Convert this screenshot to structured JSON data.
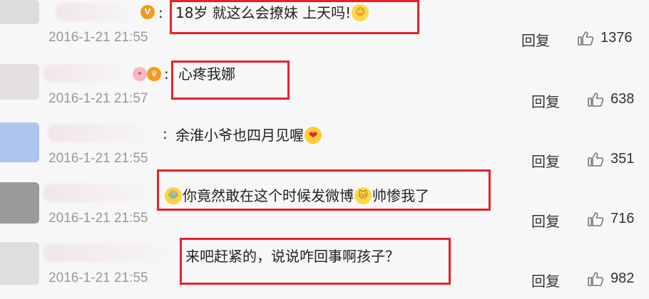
{
  "comments": [
    {
      "text": "18岁 就这么会撩妹 上天吗!",
      "emoji": "wink-emoji",
      "timestamp": "2016-1-21 21:55",
      "reply_label": "回复",
      "likes": "1376",
      "avatar_color": "#dcdcdc"
    },
    {
      "text": "心疼我娜",
      "emoji": "",
      "timestamp": "2016-1-21 21:57",
      "reply_label": "回复",
      "likes": "638",
      "avatar_color": "#e4dfe0"
    },
    {
      "text": "余淮小爷也四月见喔",
      "emoji": "heart-eyes-emoji",
      "timestamp": "2016-1-21 21:55",
      "reply_label": "回复",
      "likes": "351",
      "avatar_color": "#aec6ee"
    },
    {
      "text_before": "你竟然敢在这个时候发微博",
      "text_after": "帅惨我了",
      "emoji_before": "crying-laughing-emoji",
      "emoji_mid": "cat-emoji",
      "timestamp": "2016-1-21 21:55",
      "reply_label": "回复",
      "likes": "716",
      "avatar_color": "#9a9a9a"
    },
    {
      "text": "来吧赶紧的，说说咋回事啊孩子？",
      "timestamp": "2016-1-21 21:55",
      "reply_label": "回复",
      "likes": "982",
      "avatar_color": "#dedede"
    }
  ],
  "colors": {
    "highlight_box": "#e8202a",
    "timestamp": "#999999",
    "background": "#f7f7f7"
  }
}
